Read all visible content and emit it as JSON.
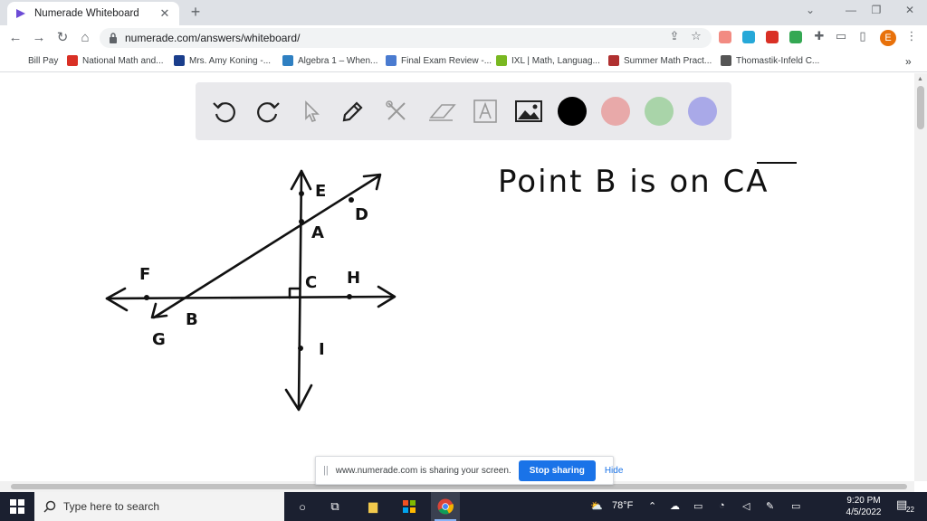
{
  "browser": {
    "tab_title": "Numerade Whiteboard",
    "tab_close": "✕",
    "new_tab": "+",
    "url": "numerade.com/answers/whiteboard/",
    "profile_initial": "E"
  },
  "bookmarks": [
    {
      "label": "Bill Pay",
      "color": "#ffffff"
    },
    {
      "label": "National Math and...",
      "color": "#d93025"
    },
    {
      "label": "Mrs. Amy Koning -...",
      "color": "#1a3e8c"
    },
    {
      "label": "Algebra 1 – When...",
      "color": "#2f80c2"
    },
    {
      "label": "Final Exam Review -...",
      "color": "#4a7bd0"
    },
    {
      "label": "IXL | Math, Languag...",
      "color": "#79b821"
    },
    {
      "label": "Summer Math Pract...",
      "color": "#b03030"
    },
    {
      "label": "Thomastik-Infeld C...",
      "color": "#555555"
    }
  ],
  "whiteboard": {
    "tools": [
      "undo-icon",
      "redo-icon",
      "pointer-icon",
      "pen-icon",
      "tools-icon",
      "eraser-icon",
      "text-icon",
      "image-icon"
    ],
    "colors": [
      "#000000",
      "#e8a9a9",
      "#a9d4a9",
      "#a9a9e8"
    ],
    "note": "Point B is on CA",
    "diagram_labels": {
      "E": "E",
      "D": "D",
      "A": "A",
      "F": "F",
      "C": "C",
      "H": "H",
      "B": "B",
      "G": "G",
      "I": "I"
    }
  },
  "sharing": {
    "message": "www.numerade.com is sharing your screen.",
    "stop_label": "Stop sharing",
    "hide_label": "Hide"
  },
  "taskbar": {
    "search_placeholder": "Type here to search",
    "weather": "78°F",
    "time": "9:20 PM",
    "date": "4/5/2022",
    "notifications": "22"
  }
}
